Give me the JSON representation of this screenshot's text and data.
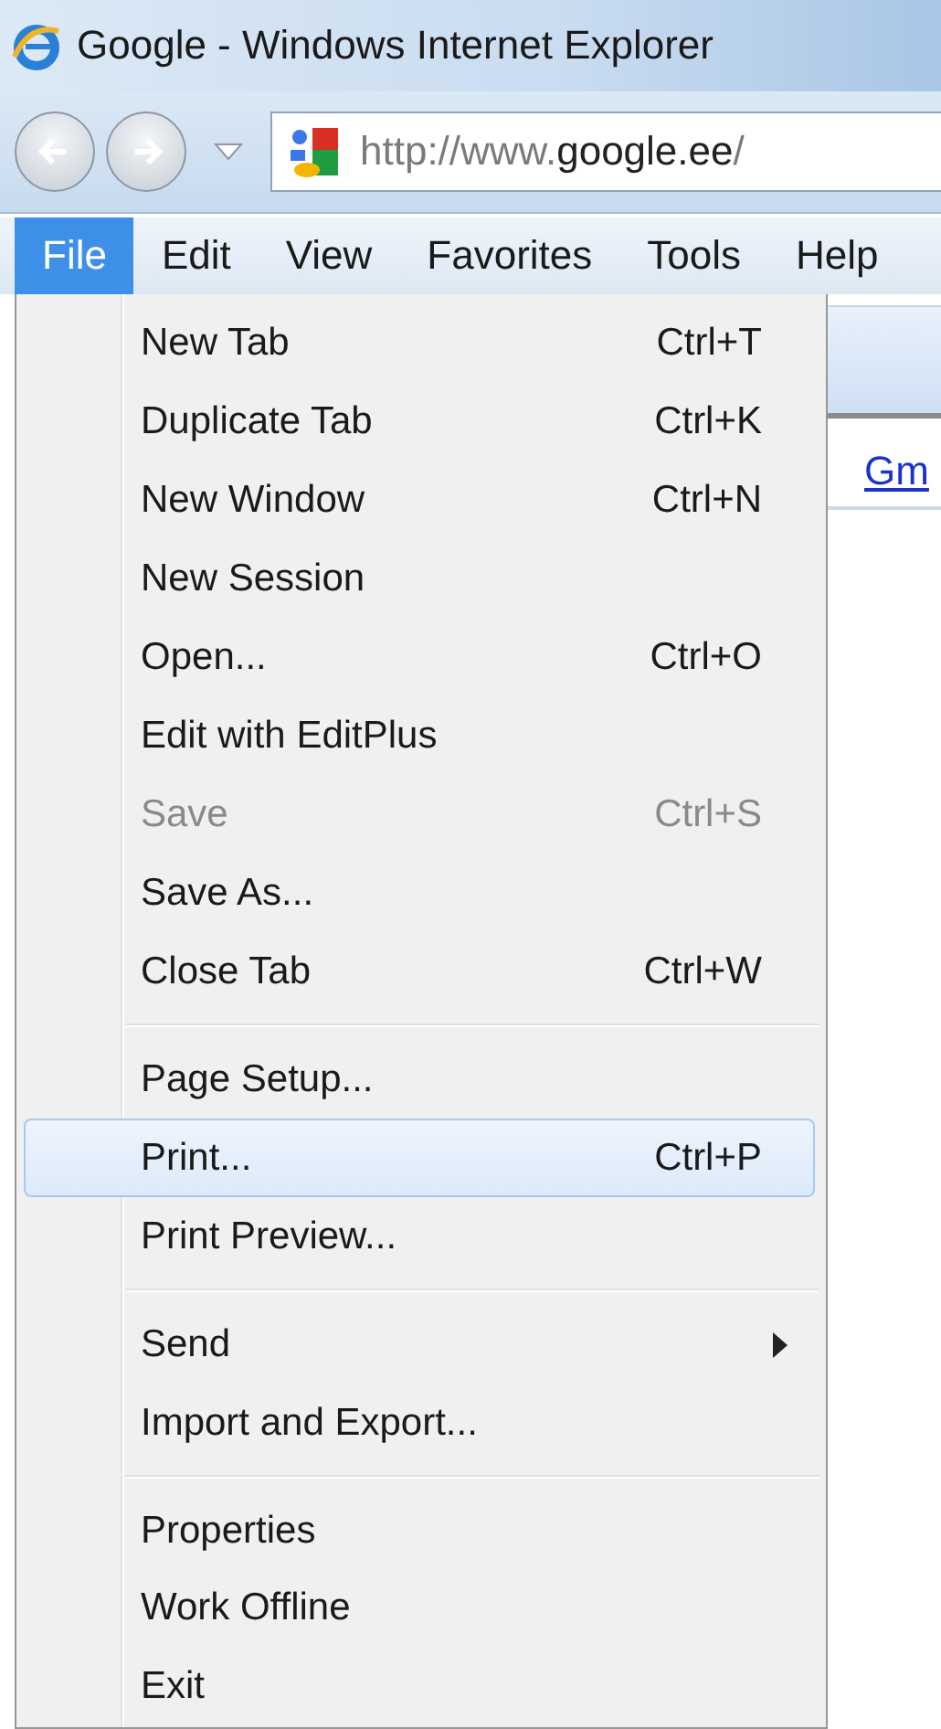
{
  "window": {
    "title": "Google - Windows Internet Explorer"
  },
  "address_bar": {
    "url": "http://www.**google.ee**/"
  },
  "menu_bar": [
    {
      "label": "File",
      "selected": true
    },
    {
      "label": "Edit",
      "selected": false
    },
    {
      "label": "View",
      "selected": false
    },
    {
      "label": "Favorites",
      "selected": false
    },
    {
      "label": "Tools",
      "selected": false
    },
    {
      "label": "Help",
      "selected": false
    }
  ],
  "file_menu": [
    {
      "kind": "item",
      "label": "New Tab",
      "shortcut": "Ctrl+T",
      "disabled": false,
      "selected": false
    },
    {
      "kind": "item",
      "label": "Duplicate Tab",
      "shortcut": "Ctrl+K",
      "disabled": false,
      "selected": false
    },
    {
      "kind": "item",
      "label": "New Window",
      "shortcut": "Ctrl+N",
      "disabled": false,
      "selected": false
    },
    {
      "kind": "item",
      "label": "New Session",
      "disabled": false,
      "selected": false
    },
    {
      "kind": "item",
      "label": "Open...",
      "shortcut": "Ctrl+O",
      "disabled": false,
      "selected": false
    },
    {
      "kind": "item",
      "label": "Edit with EditPlus",
      "disabled": false,
      "selected": false
    },
    {
      "kind": "item",
      "label": "Save",
      "shortcut": "Ctrl+S",
      "disabled": true,
      "selected": false
    },
    {
      "kind": "item",
      "label": "Save As...",
      "disabled": false,
      "selected": false
    },
    {
      "kind": "item",
      "label": "Close Tab",
      "shortcut": "Ctrl+W",
      "disabled": false,
      "selected": false
    },
    {
      "kind": "separator"
    },
    {
      "kind": "item",
      "label": "Page Setup...",
      "disabled": false,
      "selected": false
    },
    {
      "kind": "item",
      "label": "Print...",
      "shortcut": "Ctrl+P",
      "disabled": false,
      "selected": true
    },
    {
      "kind": "item",
      "label": "Print Preview...",
      "disabled": false,
      "selected": false
    },
    {
      "kind": "separator"
    },
    {
      "kind": "submenu",
      "label": "Send",
      "disabled": false,
      "selected": false
    },
    {
      "kind": "item",
      "label": "Import and Export...",
      "disabled": false,
      "selected": false
    },
    {
      "kind": "separator"
    },
    {
      "kind": "item",
      "label": "Properties",
      "disabled": false,
      "selected": false
    },
    {
      "kind": "item",
      "label": "Work Offline",
      "disabled": false,
      "selected": false
    },
    {
      "kind": "item",
      "label": "Exit",
      "disabled": false,
      "selected": false
    }
  ],
  "page": {
    "link": "Gm"
  }
}
